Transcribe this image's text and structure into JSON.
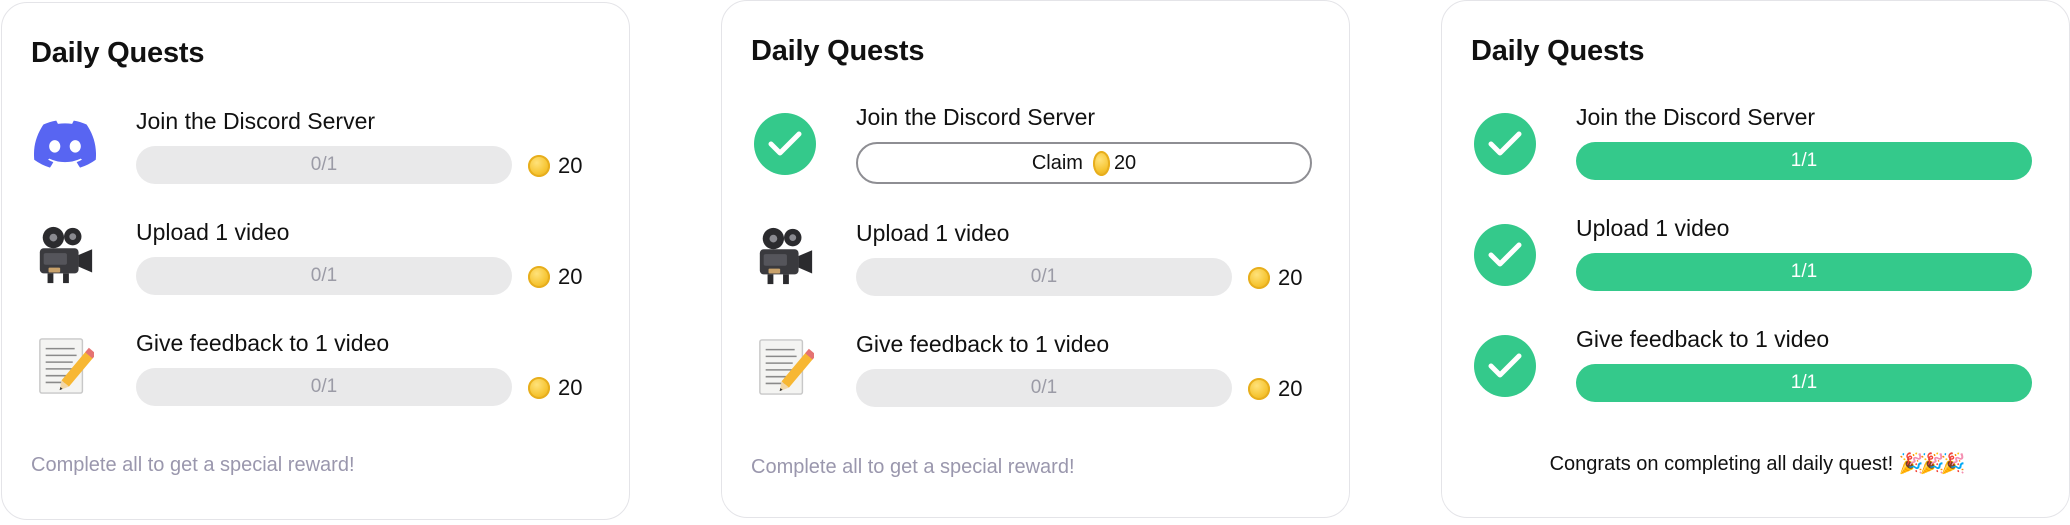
{
  "panels": [
    {
      "title": "Daily Quests",
      "quests": [
        {
          "icon": "discord-icon",
          "name": "Join the Discord Server",
          "progress": "0/1",
          "reward": "20"
        },
        {
          "icon": "movie-camera-icon",
          "name": "Upload 1 video",
          "progress": "0/1",
          "reward": "20"
        },
        {
          "icon": "memo-pencil-icon",
          "name": "Give feedback to 1 video",
          "progress": "0/1",
          "reward": "20"
        }
      ],
      "footer": "Complete all to get a special reward!"
    },
    {
      "title": "Daily Quests",
      "quests": [
        {
          "icon": "check-circle-icon",
          "name": "Join the Discord Server",
          "claim_label": "Claim",
          "reward": "20"
        },
        {
          "icon": "movie-camera-icon",
          "name": "Upload 1 video",
          "progress": "0/1",
          "reward": "20"
        },
        {
          "icon": "memo-pencil-icon",
          "name": "Give feedback to 1 video",
          "progress": "0/1",
          "reward": "20"
        }
      ],
      "footer": "Complete all to get a special reward!"
    },
    {
      "title": "Daily Quests",
      "quests": [
        {
          "icon": "check-circle-icon",
          "name": "Join the Discord Server",
          "progress": "1/1"
        },
        {
          "icon": "check-circle-icon",
          "name": "Upload 1 video",
          "progress": "1/1"
        },
        {
          "icon": "check-circle-icon",
          "name": "Give feedback to 1 video",
          "progress": "1/1"
        }
      ],
      "footer": "Congrats on completing all daily quest!",
      "footer_emoji": "🎉🎉🎉"
    }
  ],
  "colors": {
    "accent_green": "#34c98b",
    "discord_blurple": "#5865f2",
    "bar_empty": "#e9e9ea",
    "muted_text": "#9a97ad",
    "coin_gold": "#f6c533"
  }
}
